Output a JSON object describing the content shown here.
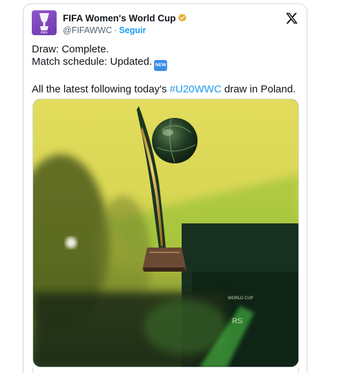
{
  "account": {
    "display_name": "FIFA Women's World Cup",
    "handle": "@FIFAWWC",
    "separator": "·",
    "follow_label": "Seguir",
    "avatar_logo_text": "FIFA",
    "verified_color": "#e8b130"
  },
  "tweet": {
    "line1": "Draw: Complete.",
    "line2": "Match schedule: Updated.",
    "new_badge": "NEW",
    "line3_prefix": "All the latest following today's ",
    "hashtag": "#U20WWC",
    "line3_suffix": " draw in Poland."
  },
  "media": {
    "description_icon": "trophy-photo",
    "box_text_1": "WORLD CUP",
    "box_text_2": "RS"
  },
  "colors": {
    "accent": "#1d9bf0",
    "avatar_bg": "#7b45bd",
    "new_badge_bg": "#3d8de8"
  }
}
